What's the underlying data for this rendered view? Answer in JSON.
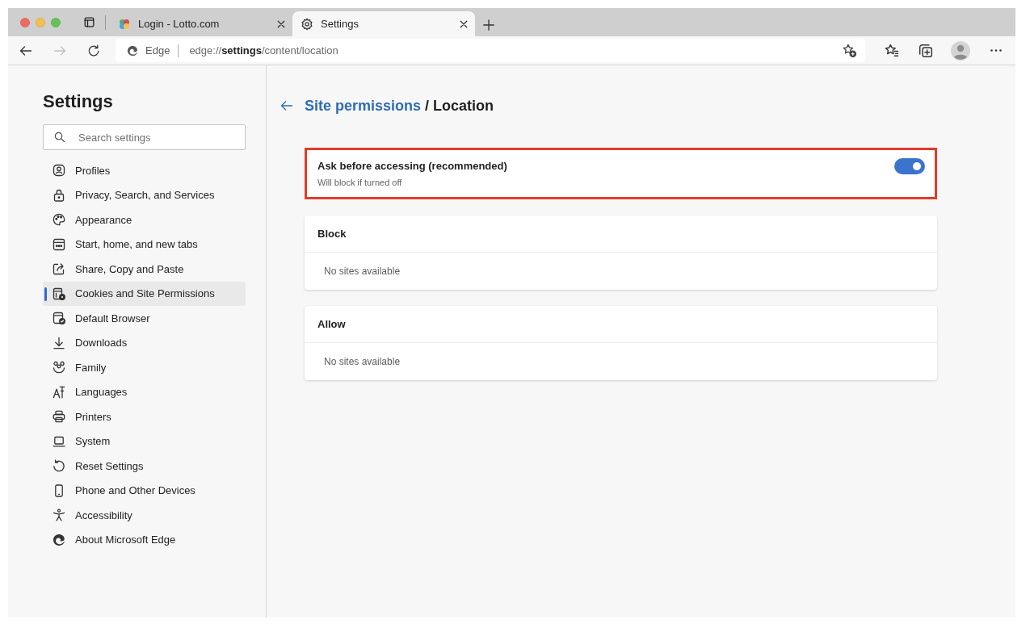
{
  "tabs": [
    {
      "title": "Login - Lotto.com",
      "kind": "site",
      "selected": false
    },
    {
      "title": "Settings",
      "kind": "settings",
      "selected": true
    }
  ],
  "navigation": [
    {
      "kind": "back",
      "disabled": false
    },
    {
      "kind": "forward",
      "disabled": true
    },
    {
      "kind": "refresh",
      "disabled": false
    }
  ],
  "address_bar": {
    "site_label": "Edge",
    "url": "edge://**settings**/content/location"
  },
  "sidebar": {
    "title": "Settings",
    "search": {
      "placeholder": "Search settings"
    },
    "items": [
      {
        "label": "Profiles",
        "selected": false
      },
      {
        "label": "Privacy, Search, and Services",
        "selected": false
      },
      {
        "label": "Appearance",
        "selected": false
      },
      {
        "label": "Start, home, and new tabs",
        "selected": false
      },
      {
        "label": "Share, Copy and Paste",
        "selected": false
      },
      {
        "label": "Cookies and Site Permissions",
        "selected": true
      },
      {
        "label": "Default Browser",
        "selected": false
      },
      {
        "label": "Downloads",
        "selected": false
      },
      {
        "label": "Family",
        "selected": false
      },
      {
        "label": "Languages",
        "selected": false
      },
      {
        "label": "Printers",
        "selected": false
      },
      {
        "label": "System",
        "selected": false
      },
      {
        "label": "Reset Settings",
        "selected": false
      },
      {
        "label": "Phone and Other Devices",
        "selected": false
      },
      {
        "label": "Accessibility",
        "selected": false
      },
      {
        "label": "About Microsoft Edge",
        "selected": false
      }
    ]
  },
  "page": {
    "breadcrumb_link": "Site permissions",
    "heading": "/ Location"
  },
  "setting": {
    "title": "Ask before accessing (recommended)",
    "description": "Will block if turned off",
    "on": true,
    "highlighted": true
  },
  "site_lists": [
    {
      "title": "Block",
      "empty_text": "No sites available"
    },
    {
      "title": "Allow",
      "empty_text": "No sites available"
    }
  ]
}
